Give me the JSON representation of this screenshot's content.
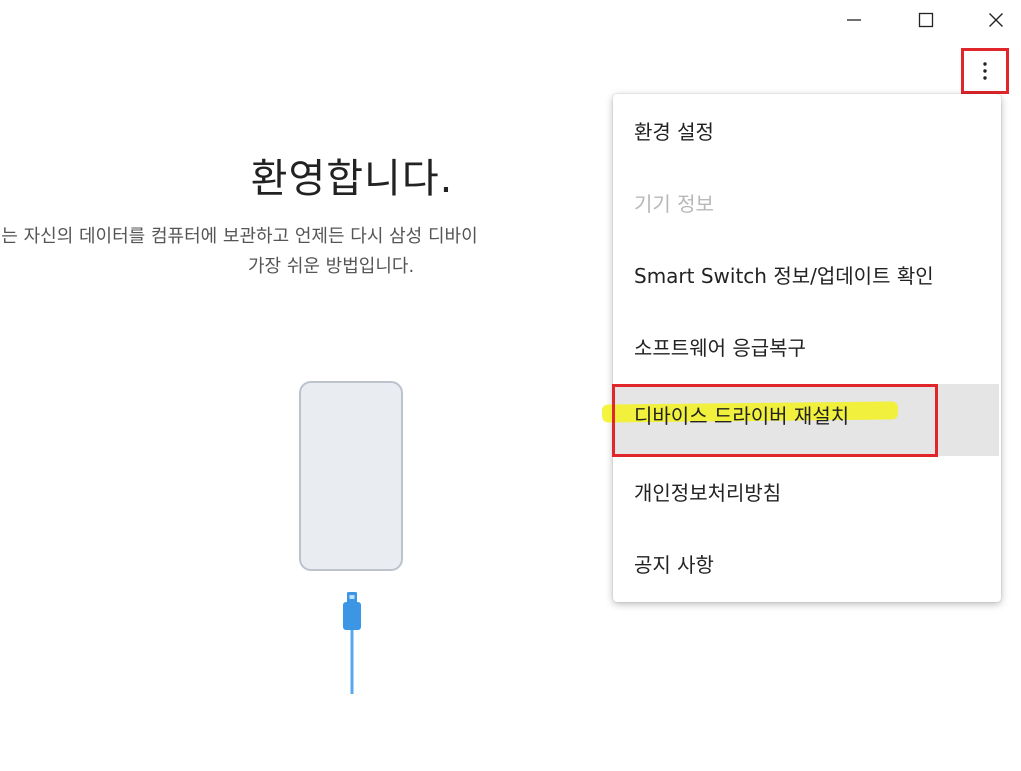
{
  "window_controls": {
    "minimize_icon": "minimize-icon",
    "maximize_icon": "maximize-icon",
    "close_icon": "close-icon"
  },
  "more_button": {
    "icon": "more-vertical-icon",
    "annotation_color": "#e0262b"
  },
  "welcome": {
    "title": "환영합니다.",
    "description_line1": "ch는 자신의 데이터를 컴퓨터에 보관하고 언제든 다시 삼성 디바이",
    "description_line2": "가장 쉬운 방법입니다."
  },
  "illustration": {
    "phone_icon": "phone-illustration",
    "cable_icon": "usb-cable-icon",
    "cable_color": "#3d95e6"
  },
  "menu": {
    "items": [
      {
        "label": "환경 설정",
        "disabled": false
      },
      {
        "label": "기기 정보",
        "disabled": true
      },
      {
        "label": "Smart Switch 정보/업데이트 확인",
        "disabled": false
      },
      {
        "label": "소프트웨어 응급복구",
        "disabled": false
      },
      {
        "label": "디바이스 드라이버 재설치",
        "disabled": false,
        "hovered": true
      },
      {
        "label": "개인정보처리방침",
        "disabled": false
      },
      {
        "label": "공지 사항",
        "disabled": false
      }
    ]
  },
  "annotations": {
    "highlight_color": "#f3f21e",
    "box_color": "#e0262b"
  }
}
